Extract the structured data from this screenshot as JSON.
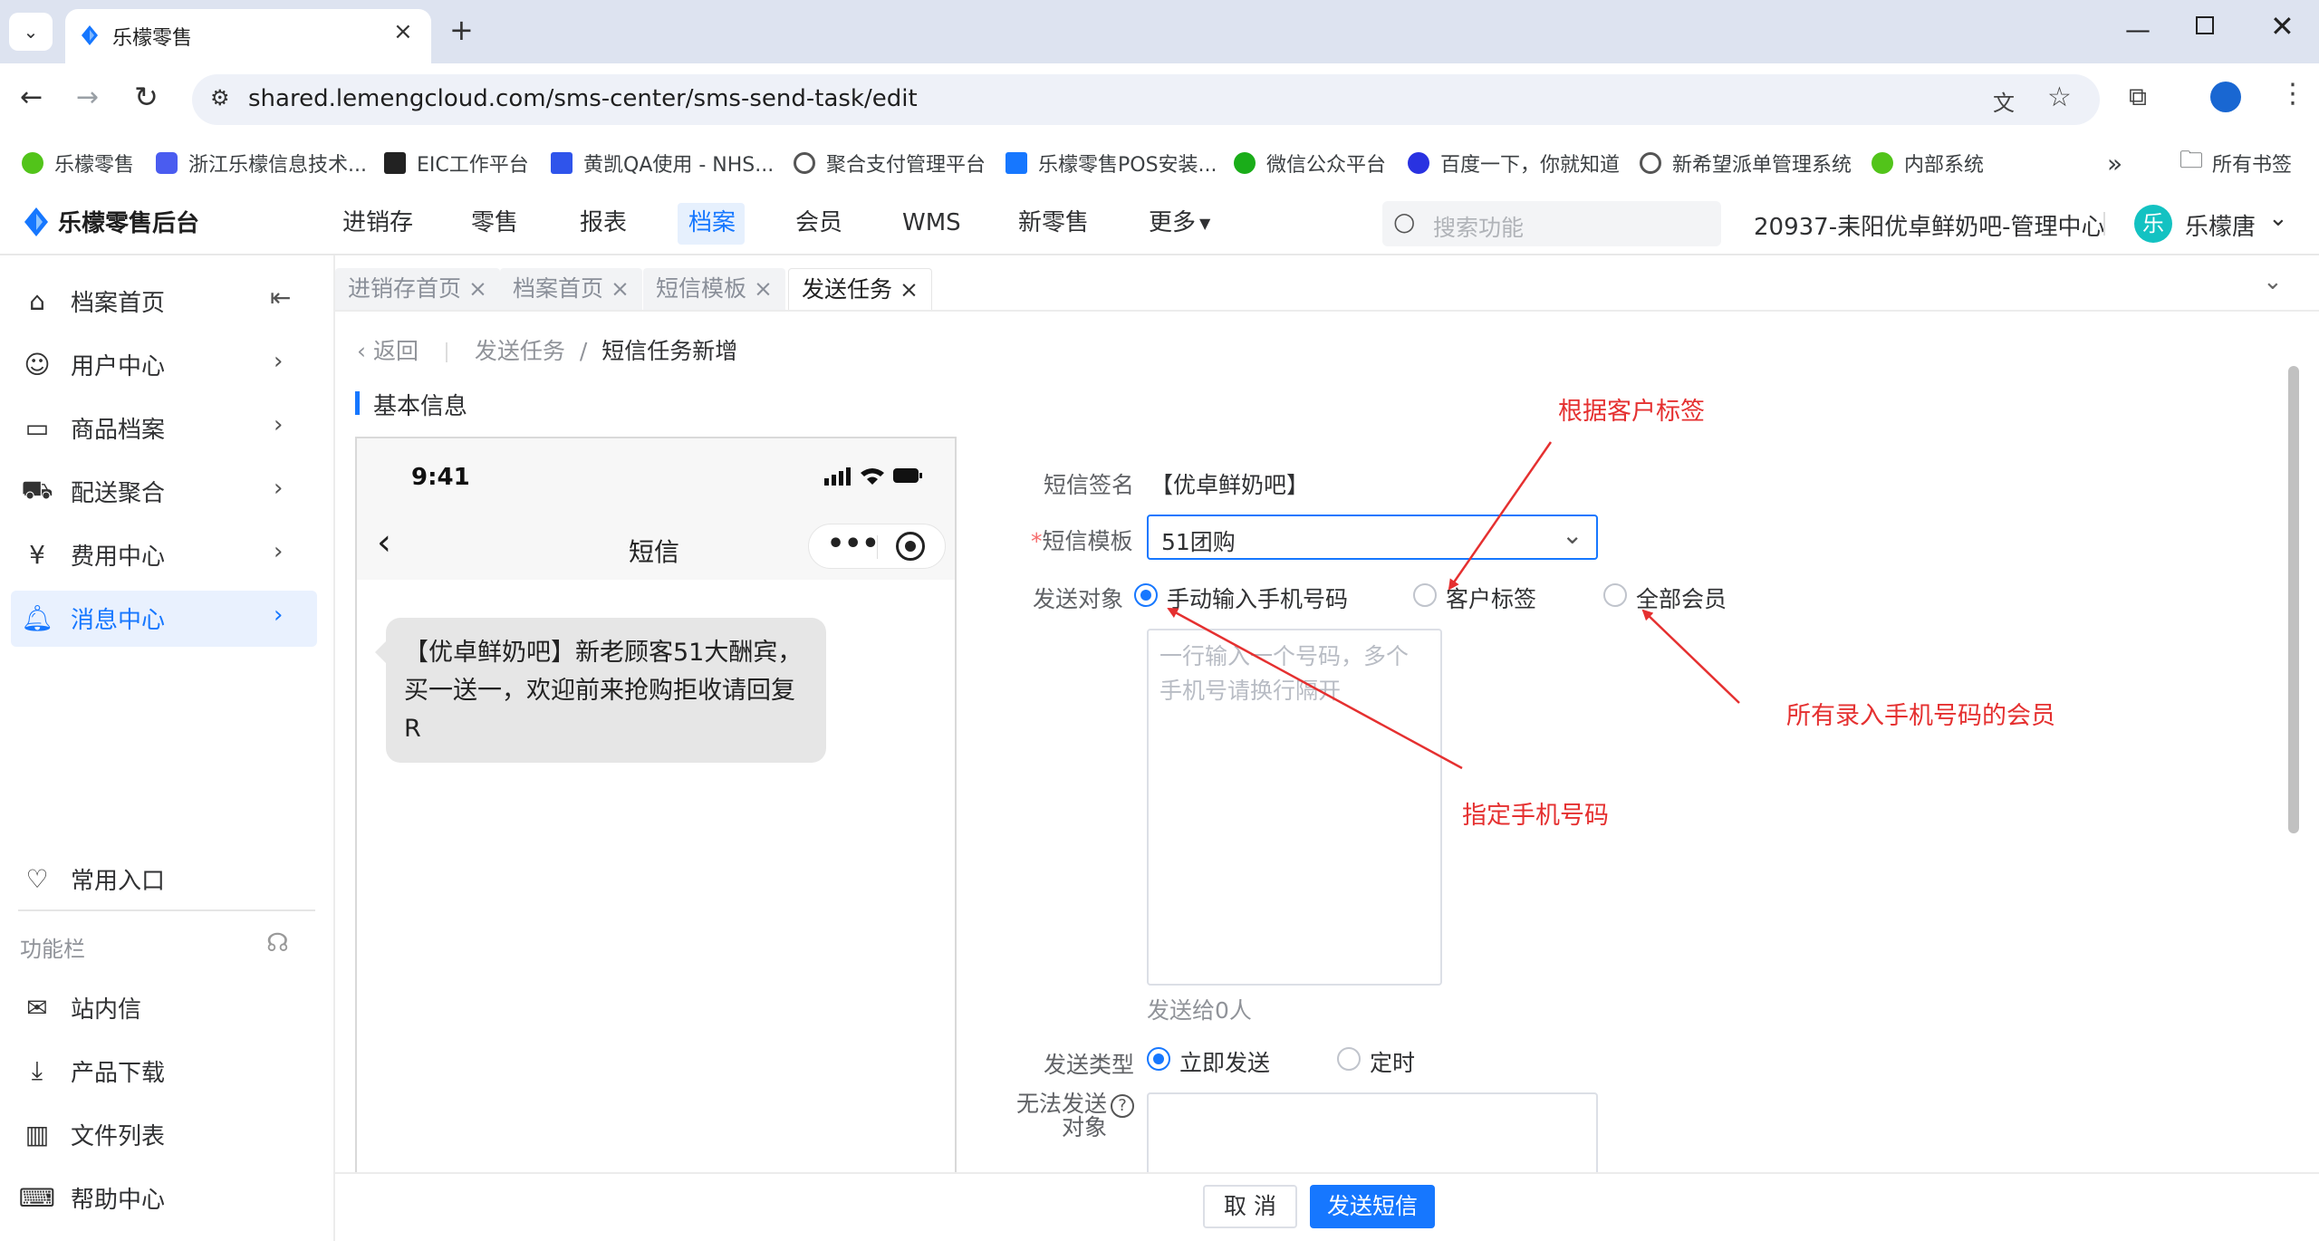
{
  "browser": {
    "tab_title": "乐檬零售",
    "url": "shared.lemengcloud.com/sms-center/sms-send-task/edit",
    "bookmarks": [
      "乐檬零售",
      "浙江乐檬信息技术...",
      "EIC工作平台",
      "黄凯QA使用 - NHS...",
      "聚合支付管理平台",
      "乐檬零售POS安装...",
      "微信公众平台",
      "百度一下，你就知道",
      "新希望派单管理系统",
      "内部系统"
    ],
    "all_bookmarks": "所有书签",
    "more_bookmarks": "»"
  },
  "header": {
    "logo": "乐檬零售后台",
    "nav": [
      "进销存",
      "零售",
      "报表",
      "档案",
      "会员",
      "WMS",
      "新零售",
      "更多"
    ],
    "active_nav": "档案",
    "search_placeholder": "搜索功能",
    "store": "20937-耒阳优卓鲜奶吧-管理中心",
    "avatar_char": "乐",
    "user": "乐檬唐"
  },
  "sidebar": {
    "items": [
      {
        "label": "档案首页",
        "icon": "home-icon"
      },
      {
        "label": "用户中心",
        "icon": "user-icon"
      },
      {
        "label": "商品档案",
        "icon": "box-icon"
      },
      {
        "label": "配送聚合",
        "icon": "truck-icon"
      },
      {
        "label": "费用中心",
        "icon": "yen-icon"
      },
      {
        "label": "消息中心",
        "icon": "bell-icon"
      }
    ],
    "common_entry": "常用入口",
    "function_bar": "功能栏",
    "bottom_items": [
      {
        "label": "站内信",
        "icon": "mail-icon"
      },
      {
        "label": "产品下载",
        "icon": "download-icon"
      },
      {
        "label": "文件列表",
        "icon": "chart-icon"
      },
      {
        "label": "帮助中心",
        "icon": "help-icon"
      }
    ]
  },
  "page_tabs": [
    "进销存首页",
    "档案首页",
    "短信模板",
    "发送任务"
  ],
  "breadcrumb": {
    "back": "返回",
    "parent": "发送任务",
    "sep": "/",
    "current": "短信任务新增"
  },
  "section_title": "基本信息",
  "phone": {
    "time": "9:41",
    "title": "短信",
    "message": "【优卓鲜奶吧】新老顾客51大酬宾，买一送一，欢迎前来抢购拒收请回复R"
  },
  "form": {
    "signature_label": "短信签名",
    "signature_value": "【优卓鲜奶吧】",
    "required_mark": "*",
    "template_label": "短信模板",
    "template_value": "51团购",
    "target_label": "发送对象",
    "target_options": [
      "手动输入手机号码",
      "客户标签",
      "全部会员"
    ],
    "target_selected": "手动输入手机号码",
    "phones_placeholder": "一行输入一个号码，多个手机号请换行隔开",
    "send_count": "发送给0人",
    "type_label": "发送类型",
    "type_options": [
      "立即发送",
      "定时"
    ],
    "type_selected": "立即发送",
    "undeliverable_label": "无法发送对象",
    "help_glyph": "?"
  },
  "annotations": {
    "by_tag": "根据客户标签",
    "all_members": "所有录入手机号码的会员",
    "specific_phones": "指定手机号码"
  },
  "footer": {
    "cancel": "取 消",
    "send": "发送短信"
  },
  "colors": {
    "primary": "#1677ff",
    "annotation": "#e53030",
    "sidebar_active": "#e9f1fe"
  }
}
